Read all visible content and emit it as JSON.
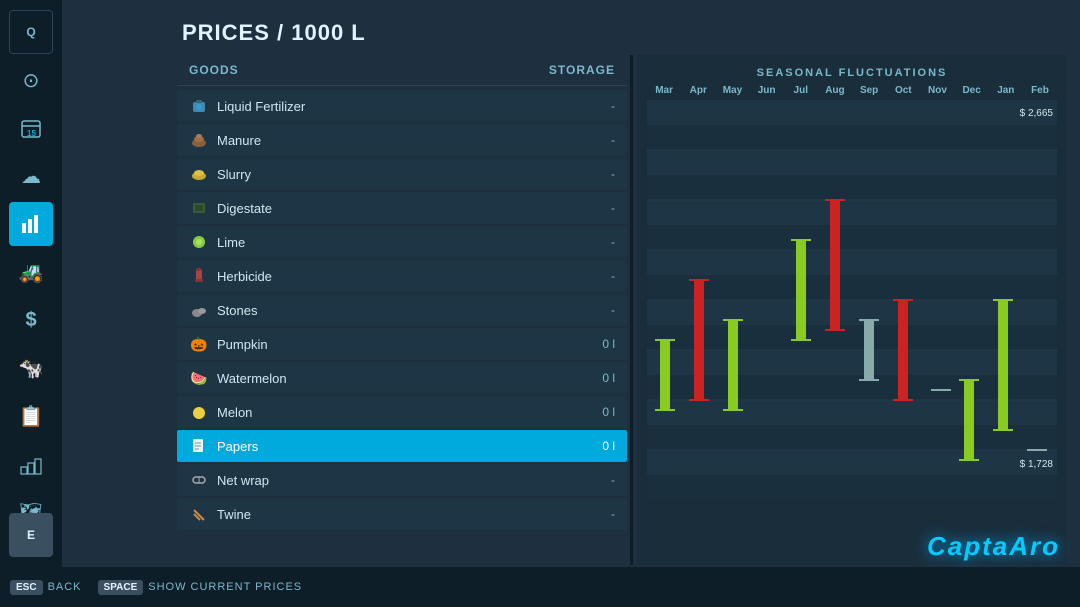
{
  "page": {
    "title": "PRICES / 1000 L"
  },
  "sidebar": {
    "items": [
      {
        "id": "quick",
        "icon": "Q",
        "label": "Quick",
        "active": false
      },
      {
        "id": "steering",
        "icon": "⊙",
        "label": "Steering",
        "active": false
      },
      {
        "id": "calendar",
        "icon": "📅",
        "label": "Calendar",
        "active": false
      },
      {
        "id": "weather",
        "icon": "☁",
        "label": "Weather",
        "active": false
      },
      {
        "id": "prices",
        "icon": "📊",
        "label": "Prices",
        "active": true
      },
      {
        "id": "vehicles",
        "icon": "🚜",
        "label": "Vehicles",
        "active": false
      },
      {
        "id": "money",
        "icon": "$",
        "label": "Money",
        "active": false
      },
      {
        "id": "animals",
        "icon": "🐄",
        "label": "Animals",
        "active": false
      },
      {
        "id": "contracts",
        "icon": "📋",
        "label": "Contracts",
        "active": false
      },
      {
        "id": "production",
        "icon": "⚙",
        "label": "Production",
        "active": false
      },
      {
        "id": "map",
        "icon": "🗺",
        "label": "Map",
        "active": false
      }
    ],
    "bottom_items": [
      {
        "id": "settings",
        "icon": "E",
        "label": "Exit"
      }
    ]
  },
  "goods": {
    "header_goods": "GOODS",
    "header_storage": "STORAGE",
    "items": [
      {
        "name": "Liquid Fertilizer",
        "icon": "💧",
        "storage": "-",
        "selected": false
      },
      {
        "name": "Manure",
        "icon": "💩",
        "storage": "-",
        "selected": false
      },
      {
        "name": "Slurry",
        "icon": "🟡",
        "storage": "-",
        "selected": false
      },
      {
        "name": "Digestate",
        "icon": "⬛",
        "storage": "-",
        "selected": false
      },
      {
        "name": "Lime",
        "icon": "🟢",
        "storage": "-",
        "selected": false
      },
      {
        "name": "Herbicide",
        "icon": "🧪",
        "storage": "-",
        "selected": false
      },
      {
        "name": "Stones",
        "icon": "🪨",
        "storage": "-",
        "selected": false
      },
      {
        "name": "Pumpkin",
        "icon": "🎃",
        "storage": "0 l",
        "selected": false
      },
      {
        "name": "Watermelon",
        "icon": "🍉",
        "storage": "0 l",
        "selected": false
      },
      {
        "name": "Melon",
        "icon": "🟡",
        "storage": "0 l",
        "selected": false
      },
      {
        "name": "Papers",
        "icon": "📄",
        "storage": "0 l",
        "selected": true
      },
      {
        "name": "Net wrap",
        "icon": "🔗",
        "storage": "-",
        "selected": false
      },
      {
        "name": "Twine",
        "icon": "📌",
        "storage": "-",
        "selected": false
      }
    ]
  },
  "chart": {
    "title": "SEASONAL FLUCTUATIONS",
    "months": [
      "Mar",
      "Apr",
      "May",
      "Jun",
      "Jul",
      "Aug",
      "Sep",
      "Oct",
      "Nov",
      "Dec",
      "Jan",
      "Feb"
    ],
    "price_high": "$ 2,665",
    "price_low": "$ 1,728"
  },
  "bottombar": {
    "keys": [
      {
        "badge": "ESC",
        "label": "BACK"
      },
      {
        "badge": "SPACE",
        "label": "SHOW CURRENT PRICES"
      }
    ]
  },
  "logo": {
    "text": "CaptaAro"
  }
}
